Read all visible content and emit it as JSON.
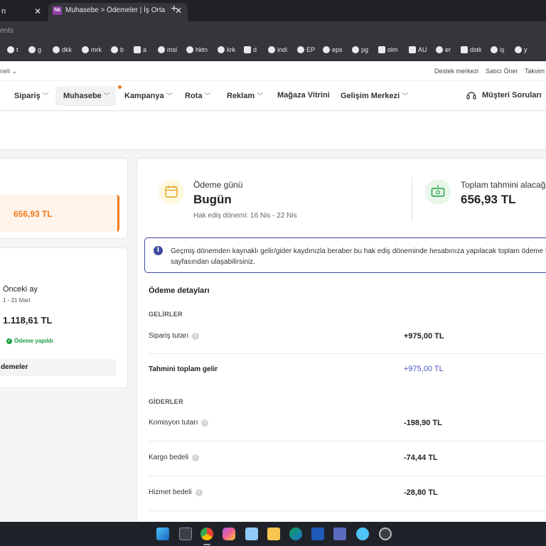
{
  "browser": {
    "prev_tab_title": "n",
    "active_tab_title": "Muhasebe > Ödemeler | İş Orta",
    "active_tab_favicon": "hb",
    "address_text": "ents",
    "bookmarks": [
      "t",
      "g",
      "dkk",
      "mrk",
      "b",
      "a",
      "msl",
      "hktn",
      "krk",
      "d",
      "indi",
      "EP",
      "eps",
      "pg",
      "olm",
      "AU",
      "er",
      "dstk",
      "iş",
      "y"
    ]
  },
  "site_top": {
    "left_label": "neli",
    "links": [
      "Destek merkezi",
      "Satıcı Öner",
      "Takvim"
    ]
  },
  "nav": {
    "items": [
      "Sipariş",
      "Muhasebe",
      "Kampanya",
      "Rota",
      "Reklam",
      "Mağaza Vitrini",
      "Gelişim Merkezi"
    ],
    "support_label": "Müşteri Soruları"
  },
  "left": {
    "current_amount": "656,93 TL",
    "prev_title": "Önceki ay",
    "prev_range": "1 - 31 Mart",
    "prev_amount": "1.118,61 TL",
    "prev_status": "Ödeme yapıldı",
    "payments_link": "demeler"
  },
  "summary": {
    "pay_day_label": "Ödeme günü",
    "pay_day_value": "Bugün",
    "period": "Hak ediş dönemi: 16 Nis - 22 Nis",
    "estimated_label": "Toplam tahmini alacağın",
    "estimated_value": "656,93 TL"
  },
  "info": {
    "line1": "Geçmiş dönemden kaynaklı gelir/gider kaydınızla beraber bu hak ediş döneminde hesabınıza yapılacak toplam ödeme t",
    "line2": "sayfasından ulaşabilirsiniz."
  },
  "details": {
    "title": "Ödeme detayları",
    "income_title": "GELİRLER",
    "order_label": "Sipariş tutarı",
    "order_value": "+975,00 TL",
    "total_income_label": "Tahmini toplam gelir",
    "total_income_value": "+975,00 TL",
    "expense_title": "GİDERLER",
    "commission_label": "Komisyon tutarı",
    "commission_value": "-198,90 TL",
    "cargo_label": "Kargo bedeli",
    "cargo_value": "-74,44 TL",
    "service_label": "Hizmet bedeli",
    "service_value": "-28,80 TL"
  },
  "colors": {
    "accent": "#f27a1a",
    "info_border": "#3e4a9e",
    "success": "#1a9e3f",
    "income_total": "#4b56c4"
  }
}
